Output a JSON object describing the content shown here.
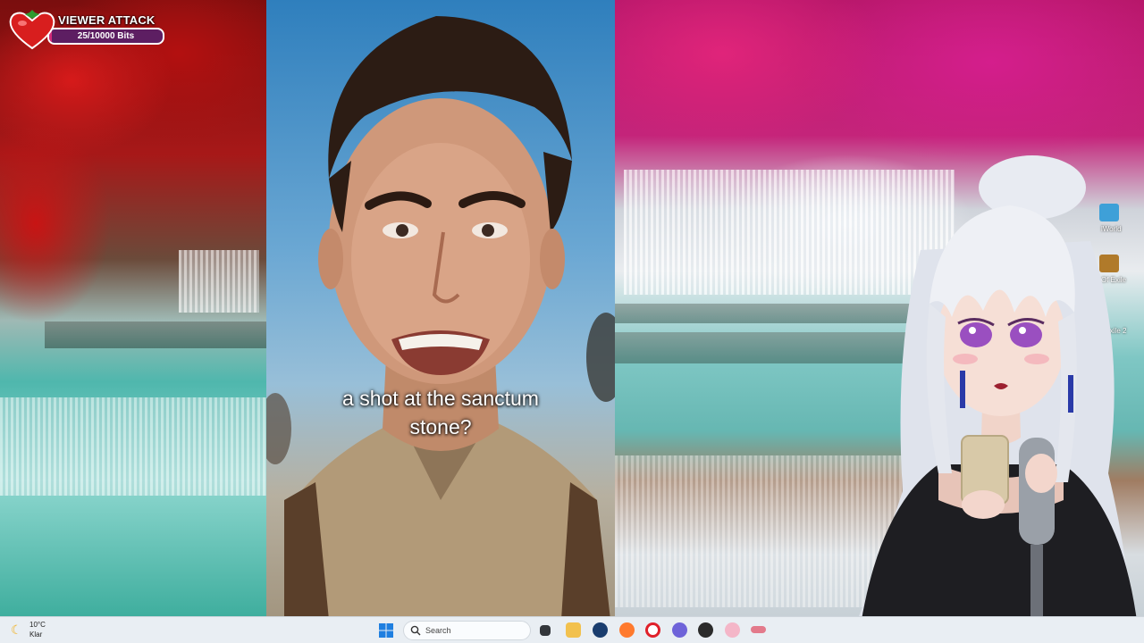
{
  "overlay": {
    "title": "VIEWER ATTACK",
    "bits_label": "25/10000 Bits",
    "bits_progress": 0.0025,
    "bar_color": "#d12c7a",
    "bar_bg": "#5d1e62"
  },
  "video": {
    "caption_line1": "a shot at the sanctum",
    "caption_line2": "stone?"
  },
  "taskbar": {
    "weather_temp": "10°C",
    "weather_condition": "Klar",
    "search_placeholder": "Search",
    "pinned_apps": [
      "start-icon",
      "task-view-icon",
      "file-explorer-icon",
      "store-icon",
      "steam-icon",
      "browser-icon",
      "opera-icon",
      "chat-app-icon",
      "discord-icon",
      "app-icon",
      "heart-app-icon",
      "tool-icon"
    ]
  },
  "desktop": {
    "icons": [
      {
        "name": "game-icon-1",
        "label": "lWorld"
      },
      {
        "name": "game-icon-2",
        "label": "Of Exile"
      },
      {
        "name": "game-icon-3",
        "label": "f Exile 2"
      }
    ]
  }
}
